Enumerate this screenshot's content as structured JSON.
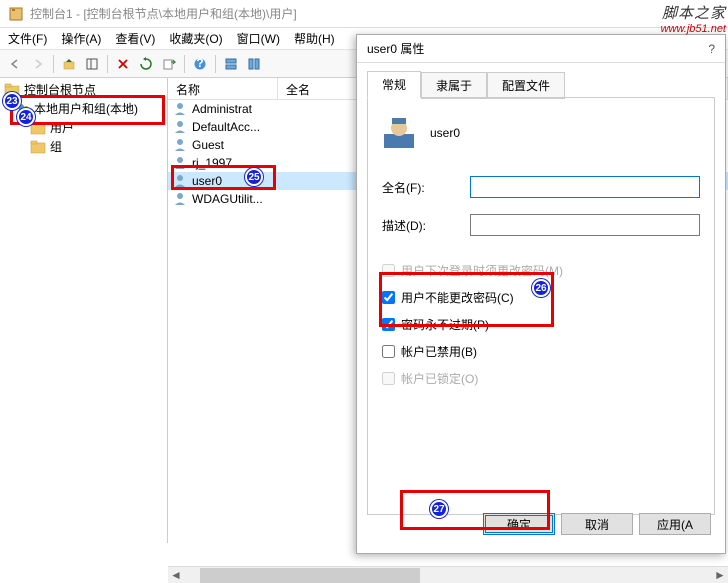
{
  "window": {
    "title": "控制台1 - [控制台根节点\\本地用户和组(本地)\\用户]"
  },
  "menubar": [
    "文件(F)",
    "操作(A)",
    "查看(V)",
    "收藏夹(O)",
    "窗口(W)",
    "帮助(H)"
  ],
  "tree": {
    "root": "控制台根节点",
    "group": "本地用户和组(本地)",
    "users": "用户",
    "groups": "组"
  },
  "list": {
    "cols": {
      "name": "名称",
      "fullname": "全名"
    },
    "rows": [
      "Administrat",
      "DefaultAcc...",
      "Guest",
      "rj_1997",
      "user0",
      "WDAGUtilit..."
    ]
  },
  "dialog": {
    "title": "user0 属性",
    "help": "?",
    "tabs": [
      "常规",
      "隶属于",
      "配置文件"
    ],
    "username": "user0",
    "labels": {
      "fullname": "全名(F):",
      "desc": "描述(D):",
      "mustChange": "用户下次登录时须更改密码(M)",
      "cantChange": "用户不能更改密码(C)",
      "neverExpire": "密码永不过期(P)",
      "disabled": "帐户已禁用(B)",
      "locked": "帐户已锁定(O)"
    },
    "values": {
      "fullname": "",
      "desc": ""
    },
    "checks": {
      "mustChange": false,
      "cantChange": true,
      "neverExpire": true,
      "disabled": false,
      "locked": false
    },
    "buttons": {
      "ok": "确定",
      "cancel": "取消",
      "apply": "应用(A"
    }
  },
  "watermark": {
    "cn": "脚本之家",
    "en": "www.jb51.net"
  },
  "badges": {
    "b23": "23",
    "b24": "24",
    "b25": "25",
    "b26": "26",
    "b27": "27"
  }
}
